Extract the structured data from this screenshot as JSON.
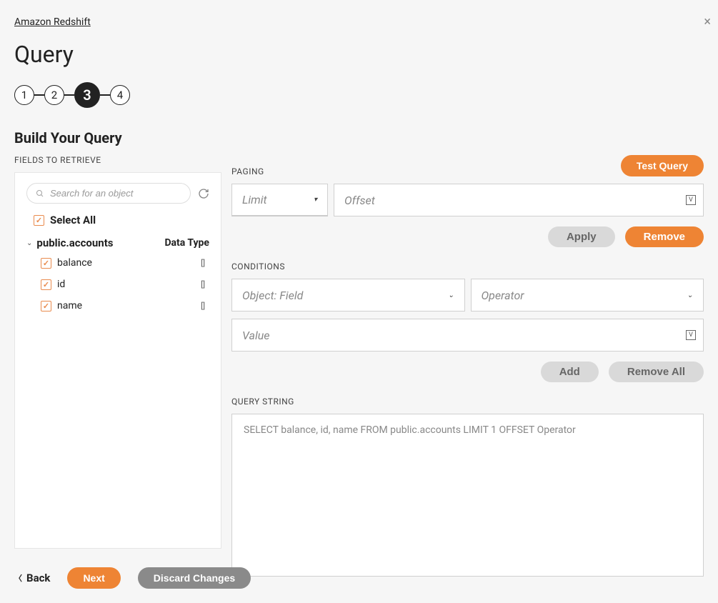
{
  "breadcrumb": {
    "link": "Amazon Redshift"
  },
  "page_title": "Query",
  "stepper": {
    "steps": [
      "1",
      "2",
      "3",
      "4"
    ],
    "active_index": 2
  },
  "section_header": "Build Your Query",
  "left": {
    "fields_label": "FIELDS TO RETRIEVE",
    "search_placeholder": "Search for an object",
    "select_all_label": "Select All",
    "table_name": "public.accounts",
    "data_type_header": "Data Type",
    "fields": [
      {
        "name": "balance",
        "type_icon": "[]"
      },
      {
        "name": "id",
        "type_icon": "[]"
      },
      {
        "name": "name",
        "type_icon": "[]"
      }
    ]
  },
  "right": {
    "test_query_label": "Test Query",
    "paging_label": "PAGING",
    "limit_placeholder": "Limit",
    "offset_placeholder": "Offset",
    "apply_label": "Apply",
    "remove_label": "Remove",
    "conditions_label": "CONDITIONS",
    "object_field_placeholder": "Object: Field",
    "operator_placeholder": "Operator",
    "value_placeholder": "Value",
    "add_label": "Add",
    "remove_all_label": "Remove All",
    "query_string_label": "QUERY STRING",
    "query_string_value": "SELECT balance, id, name FROM public.accounts  LIMIT 1  OFFSET Operator"
  },
  "bottom": {
    "back_label": "Back",
    "next_label": "Next",
    "discard_label": "Discard Changes"
  }
}
